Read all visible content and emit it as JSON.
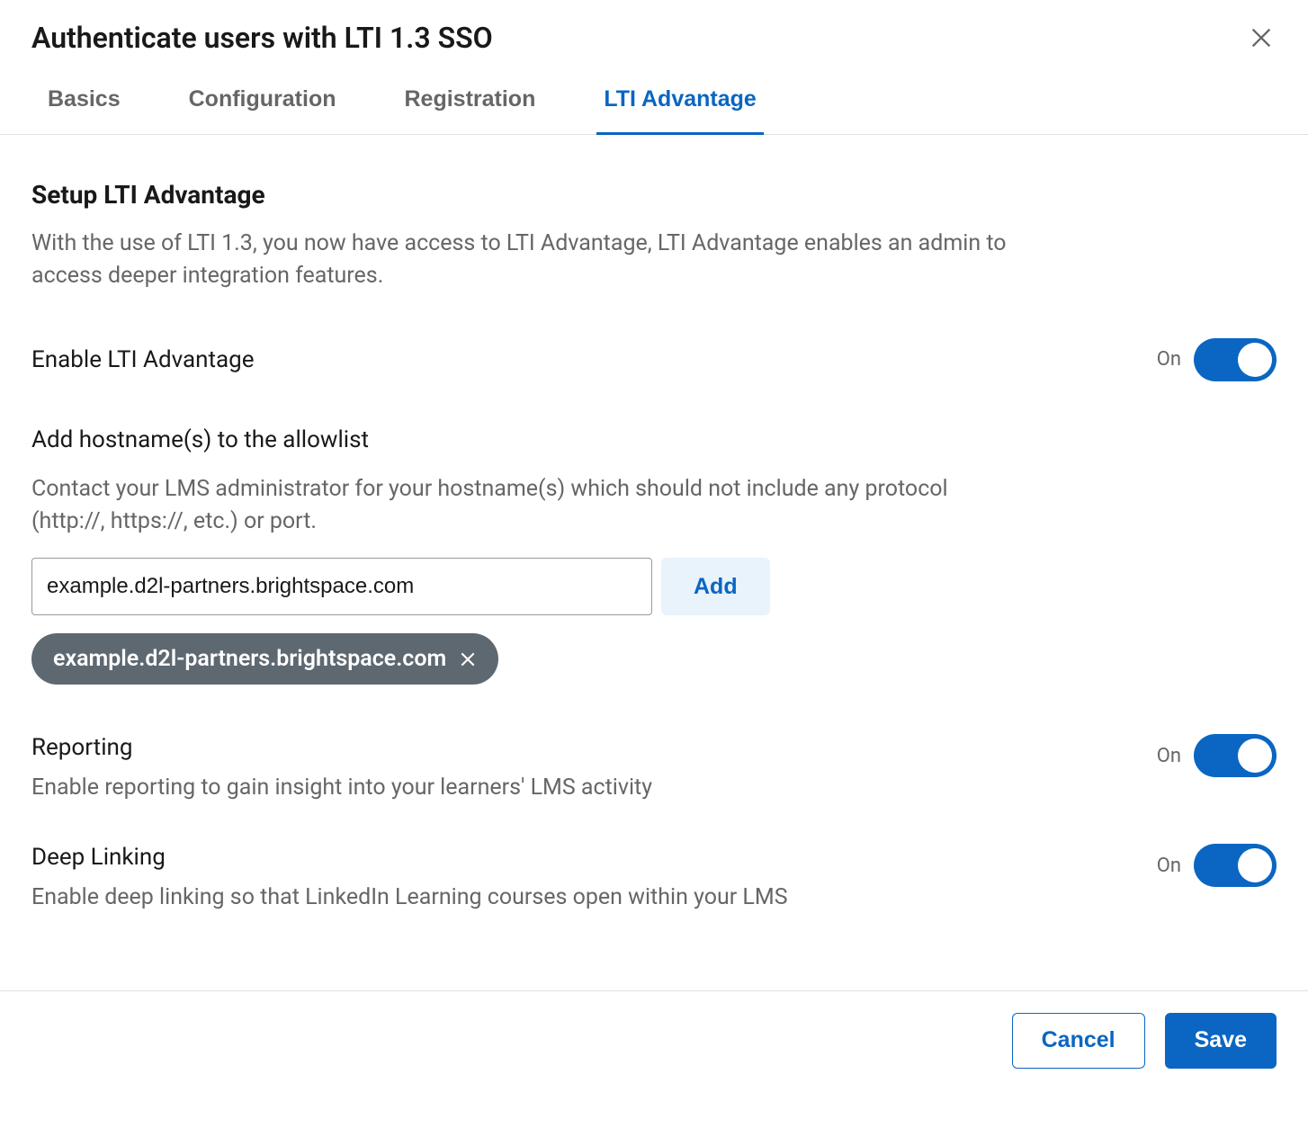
{
  "header": {
    "title": "Authenticate users with LTI 1.3 SSO"
  },
  "tabs": [
    {
      "label": "Basics",
      "active": false
    },
    {
      "label": "Configuration",
      "active": false
    },
    {
      "label": "Registration",
      "active": false
    },
    {
      "label": "LTI Advantage",
      "active": true
    }
  ],
  "section": {
    "title": "Setup LTI Advantage",
    "description": "With the use of LTI 1.3, you now have access to LTI Advantage, LTI Advantage enables an admin to access deeper integration features."
  },
  "enable": {
    "label": "Enable LTI Advantage",
    "state": "On"
  },
  "allowlist": {
    "title": "Add hostname(s) to the allowlist",
    "description": "Contact your LMS administrator for your hostname(s) which should not include any protocol (http://, https://, etc.) or port.",
    "input_value": "example.d2l-partners.brightspace.com",
    "add_label": "Add",
    "chips": [
      {
        "label": "example.d2l-partners.brightspace.com"
      }
    ]
  },
  "reporting": {
    "title": "Reporting",
    "description": "Enable reporting to gain insight into your learners' LMS activity",
    "state": "On"
  },
  "deeplinking": {
    "title": "Deep Linking",
    "description": "Enable deep linking so that LinkedIn Learning courses open within your LMS",
    "state": "On"
  },
  "footer": {
    "cancel": "Cancel",
    "save": "Save"
  }
}
